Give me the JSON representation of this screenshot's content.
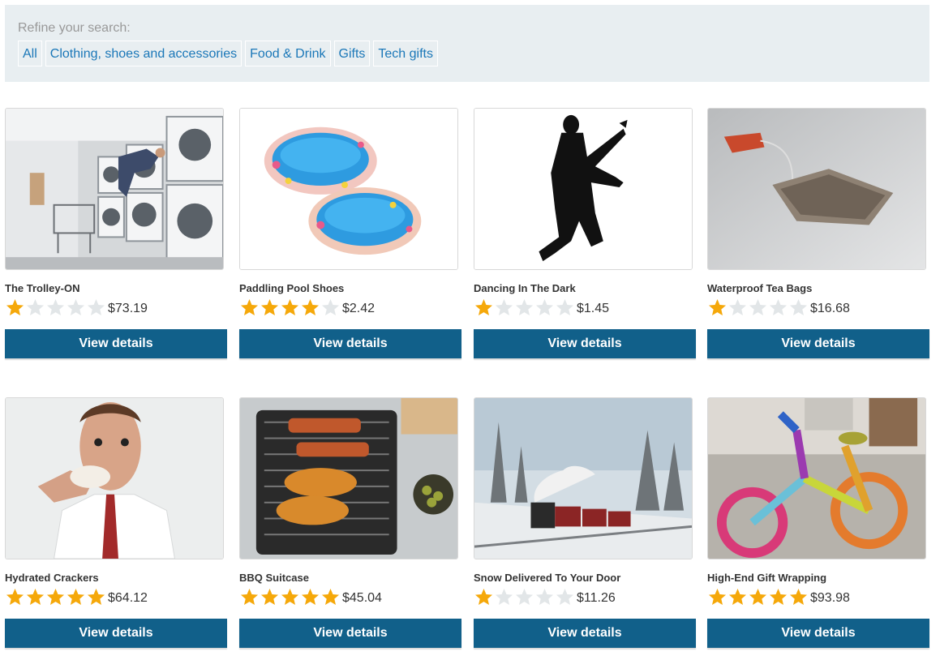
{
  "refine": {
    "label": "Refine your search:",
    "filters": [
      "All",
      "Clothing, shoes and accessories",
      "Food & Drink",
      "Gifts",
      "Tech gifts"
    ]
  },
  "colors": {
    "button": "#11608a",
    "filter_link": "#1a77b8",
    "star_filled": "#f5a80a",
    "star_empty": "#e2e6e8"
  },
  "products": [
    {
      "name": "The Trolley-ON",
      "rating": 1,
      "price": "$73.19",
      "button": "View details",
      "image": "laundromat-photo"
    },
    {
      "name": "Paddling Pool Shoes",
      "rating": 4,
      "price": "$2.42",
      "button": "View details",
      "image": "paddling-pools-photo"
    },
    {
      "name": "Dancing In The Dark",
      "rating": 1,
      "price": "$1.45",
      "button": "View details",
      "image": "dancing-silhouette"
    },
    {
      "name": "Waterproof Tea Bags",
      "rating": 1,
      "price": "$16.68",
      "button": "View details",
      "image": "tea-bag-photo"
    },
    {
      "name": "Hydrated Crackers",
      "rating": 5,
      "price": "$64.12",
      "button": "View details",
      "image": "man-eating-cracker-photo"
    },
    {
      "name": "BBQ Suitcase",
      "rating": 5,
      "price": "$45.04",
      "button": "View details",
      "image": "bbq-grill-photo"
    },
    {
      "name": "Snow Delivered To Your Door",
      "rating": 1,
      "price": "$11.26",
      "button": "View details",
      "image": "snow-train-photo"
    },
    {
      "name": "High-End Gift Wrapping",
      "rating": 5,
      "price": "$93.98",
      "button": "View details",
      "image": "knitted-bicycle-photo"
    }
  ]
}
